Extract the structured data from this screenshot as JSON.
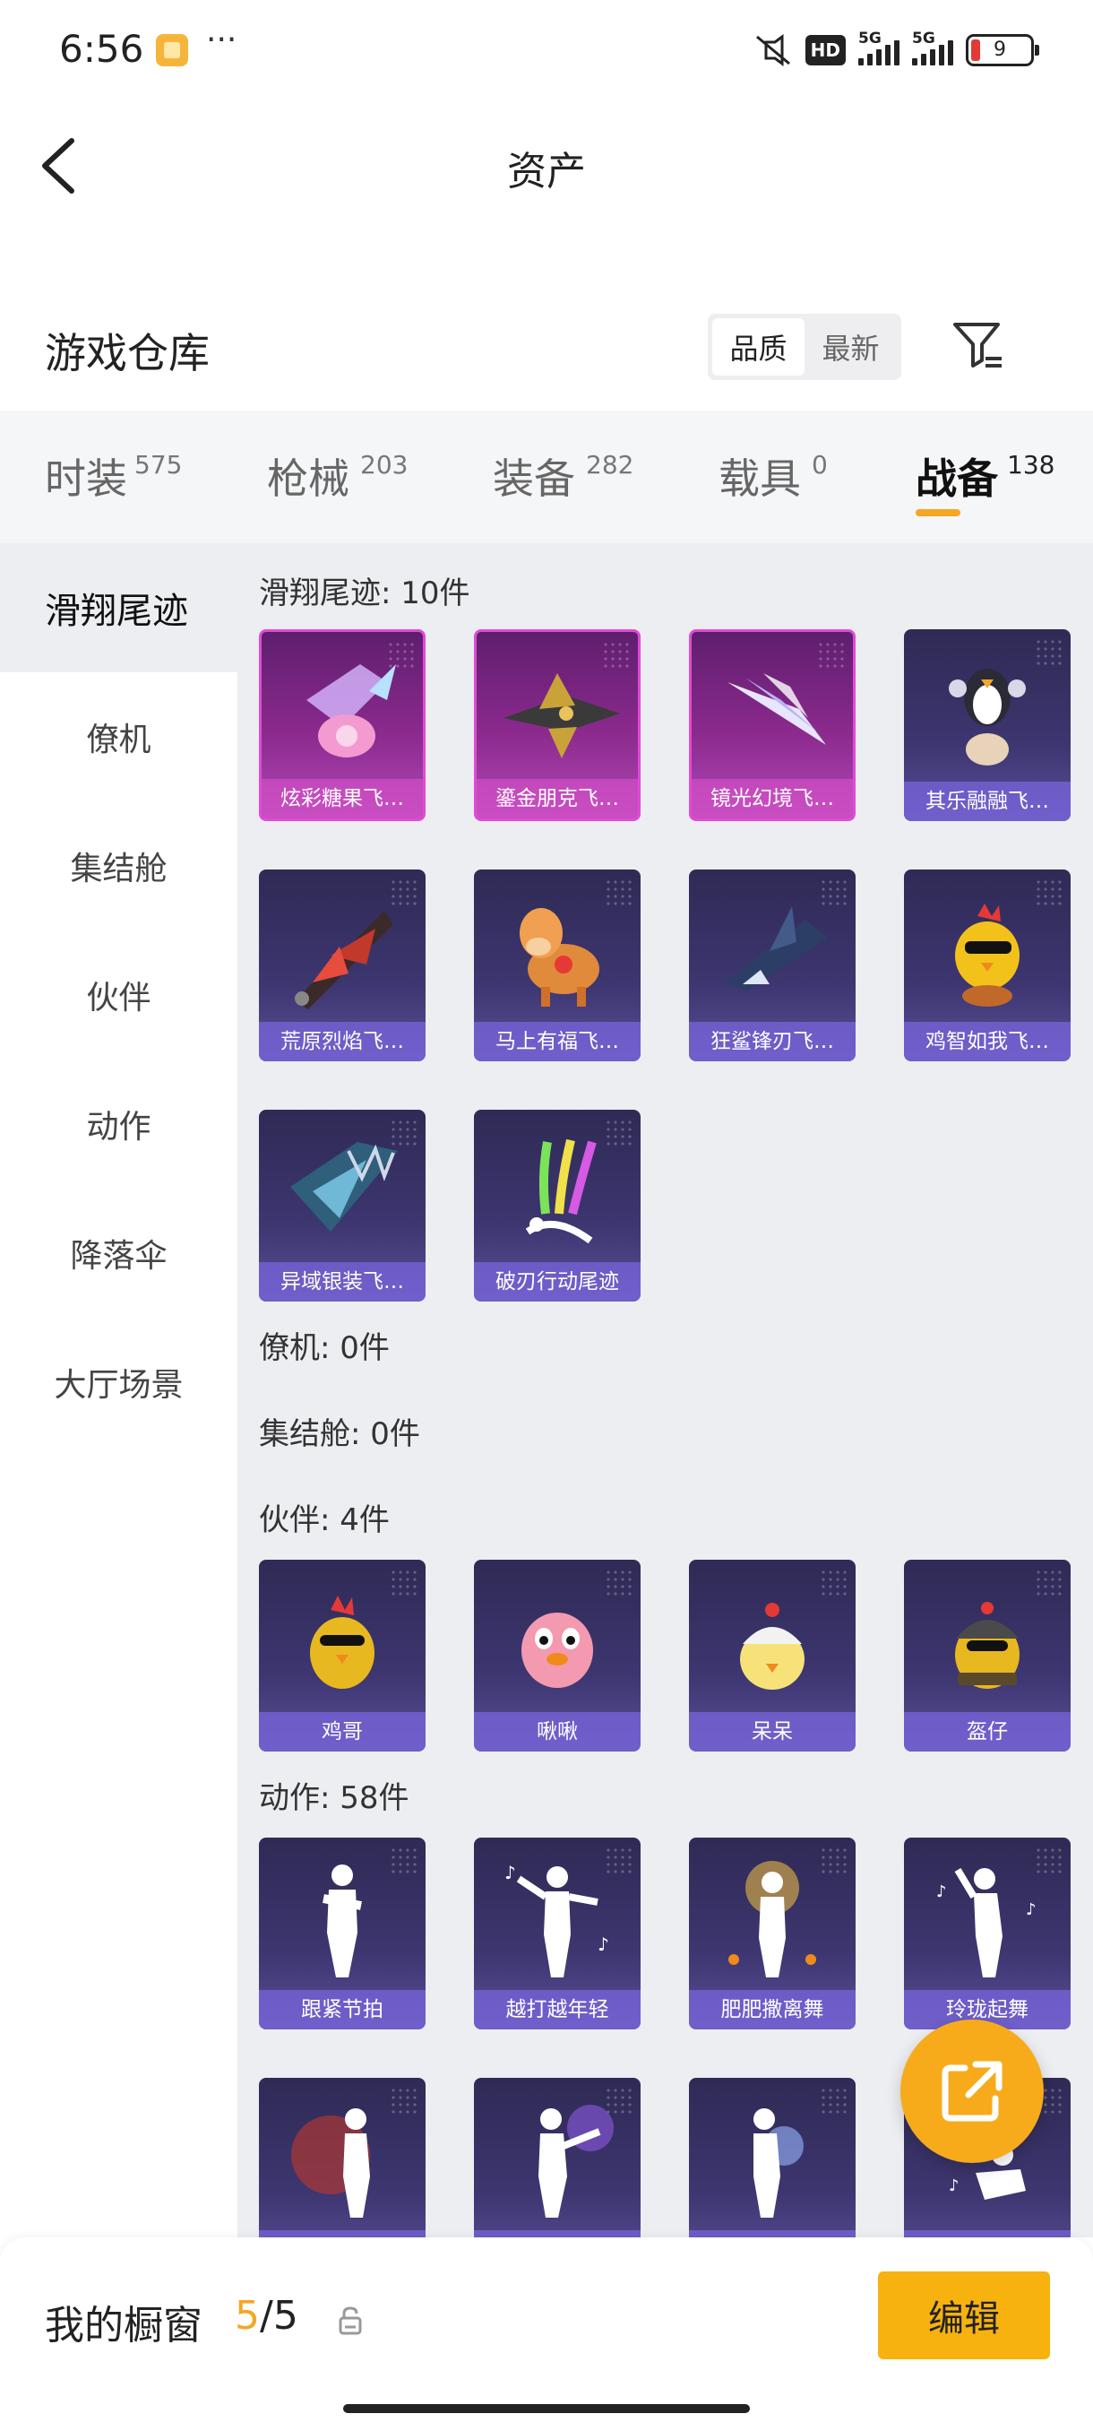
{
  "status_bar": {
    "time": "6:56",
    "dots": "···",
    "hd": "HD",
    "signal1": "5G",
    "signal2": "5G",
    "battery": "9"
  },
  "header": {
    "title": "资产"
  },
  "section": {
    "title": "游戏仓库",
    "sort_options": [
      "品质",
      "最新"
    ],
    "sort_active": "品质"
  },
  "main_tabs": [
    {
      "label": "时装",
      "count": "575"
    },
    {
      "label": "枪械",
      "count": "203"
    },
    {
      "label": "装备",
      "count": "282"
    },
    {
      "label": "载具",
      "count": "0"
    },
    {
      "label": "战备",
      "count": "138",
      "active": true
    }
  ],
  "categories": [
    {
      "label": "滑翔尾迹",
      "active": true
    },
    {
      "label": "僚机"
    },
    {
      "label": "集结舱"
    },
    {
      "label": "伙伴"
    },
    {
      "label": "动作"
    },
    {
      "label": "降落伞"
    },
    {
      "label": "大厅场景"
    }
  ],
  "groups": {
    "glide": {
      "label": "滑翔尾迹: 10件",
      "items": [
        {
          "name": "炫彩糖果飞…",
          "icon": "candy-glider-icon",
          "rarity": "pink"
        },
        {
          "name": "鎏金朋克飞…",
          "icon": "punk-plane-icon",
          "rarity": "pink"
        },
        {
          "name": "镜光幻境飞…",
          "icon": "crystal-wing-icon",
          "rarity": "pink"
        },
        {
          "name": "其乐融融飞…",
          "icon": "penguin-glider-icon"
        },
        {
          "name": "荒原烈焰飞…",
          "icon": "flame-glider-icon"
        },
        {
          "name": "马上有福飞…",
          "icon": "horse-toy-icon"
        },
        {
          "name": "狂鲨锋刃飞…",
          "icon": "shark-glider-icon"
        },
        {
          "name": "鸡智如我飞…",
          "icon": "chicken-glider-icon"
        },
        {
          "name": "异域银装飞…",
          "icon": "silver-wing-icon"
        },
        {
          "name": "破刃行动尾迹",
          "icon": "smoke-trail-icon"
        }
      ]
    },
    "wingman": {
      "label": "僚机: 0件"
    },
    "pod": {
      "label": "集结舱: 0件"
    },
    "partner": {
      "label": "伙伴: 4件",
      "items": [
        {
          "name": "鸡哥",
          "icon": "chicken-icon"
        },
        {
          "name": "啾啾",
          "icon": "pink-bird-icon"
        },
        {
          "name": "呆呆",
          "icon": "chick-icon"
        },
        {
          "name": "盔仔",
          "icon": "helmet-chicken-icon"
        }
      ]
    },
    "emote": {
      "label": "动作: 58件",
      "items": [
        {
          "name": "跟紧节拍",
          "icon": "dance-pose-icon"
        },
        {
          "name": "越打越年轻",
          "icon": "dance-music-icon"
        },
        {
          "name": "肥肥撒离舞",
          "icon": "dance-sparkle-icon"
        },
        {
          "name": "玲珑起舞",
          "icon": "dance-twirl-icon"
        },
        {
          "name": "",
          "icon": "dance-fire-icon"
        },
        {
          "name": "",
          "icon": "dance-kick-icon"
        },
        {
          "name": "",
          "icon": "dance-orb-icon"
        },
        {
          "name": "",
          "icon": "dance-sit-icon"
        }
      ]
    }
  },
  "bottom_bar": {
    "label": "我的橱窗",
    "count_current": "5",
    "count_total": "/5",
    "edit_label": "编辑"
  },
  "colors": {
    "accent": "#f5a623",
    "button": "#f7b20f",
    "tile_purple": "#3d3670",
    "tile_pink": "#b04ab8"
  }
}
